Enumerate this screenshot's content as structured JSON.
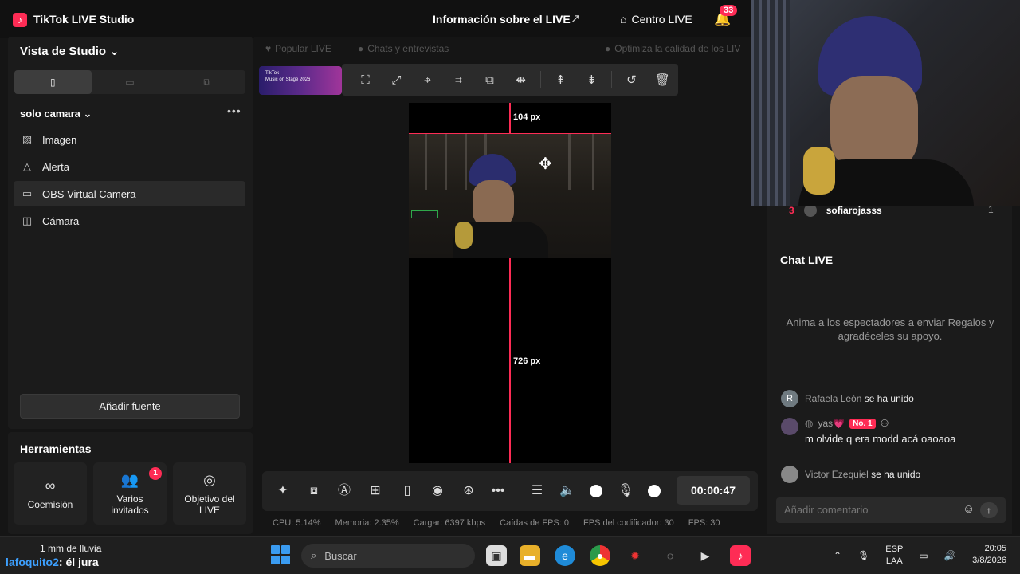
{
  "app": {
    "logo": "♪",
    "title": "TikTok LIVE Studio",
    "live_info": "Información sobre el LIVE",
    "centro_live": "Centro LIVE",
    "notifications": "33"
  },
  "left_panel": {
    "studio_view": "Vista de Studio",
    "scene": "solo camara",
    "sources": [
      {
        "label": "Imagen",
        "icon": "image-icon"
      },
      {
        "label": "Alerta",
        "icon": "bell-icon"
      },
      {
        "label": "OBS Virtual Camera",
        "icon": "video-camera-icon"
      },
      {
        "label": "Cámara",
        "icon": "camera-icon"
      }
    ],
    "add_source": "Añadir fuente"
  },
  "tools": {
    "title": "Herramientas",
    "items": [
      {
        "label": "Coemisión"
      },
      {
        "label": "Varios invitados",
        "badge": "1"
      },
      {
        "label": "Objetivo del LIVE"
      }
    ]
  },
  "center": {
    "pills": [
      "Popular LIVE",
      "Chats y entrevistas",
      "Optimiza la calidad de los LIV"
    ],
    "promo_line1": "TikTok",
    "promo_line2": "Music on Stage 2026",
    "dim_top": "104 px",
    "dim_bottom": "726 px",
    "timer": "00:00:47",
    "stats": [
      {
        "label": "CPU:",
        "value": "5.14%"
      },
      {
        "label": "Memoria:",
        "value": "2.35%"
      },
      {
        "label": "Cargar:",
        "value": "6397 kbps"
      },
      {
        "label": "Caídas de FPS:",
        "value": "0"
      },
      {
        "label": "FPS del codificador:",
        "value": "30"
      },
      {
        "label": "FPS:",
        "value": "30"
      }
    ]
  },
  "right_panel": {
    "rank": "3",
    "rank_user": "sofiarojasss",
    "rank_value": "1",
    "chat_title": "Chat LIVE",
    "chat_empty": "Anima a los espectadores a enviar Regalos y agradéceles su apoyo.",
    "messages": [
      {
        "avatar": "R",
        "user": "Rafaela León",
        "text": "se ha unido"
      },
      {
        "avatar": "",
        "user": "yas💗",
        "badge": "No. 1",
        "text": "m olvide q era modd acá oaoaoa"
      },
      {
        "avatar": "",
        "user": "Victor Ezequiel",
        "text": "se ha unido"
      }
    ],
    "comment_placeholder": "Añadir comentario"
  },
  "taskbar": {
    "weather": "1 mm de lluvia",
    "overlay_user": "lafoquito2",
    "overlay_text": ": él jura",
    "search": "Buscar",
    "lang1": "ESP",
    "lang2": "LAA",
    "time": "20:05",
    "date": "3/8/2026"
  },
  "colors": {
    "accent": "#fe2c55",
    "background": "#151515",
    "panel": "#1b1b1b"
  }
}
